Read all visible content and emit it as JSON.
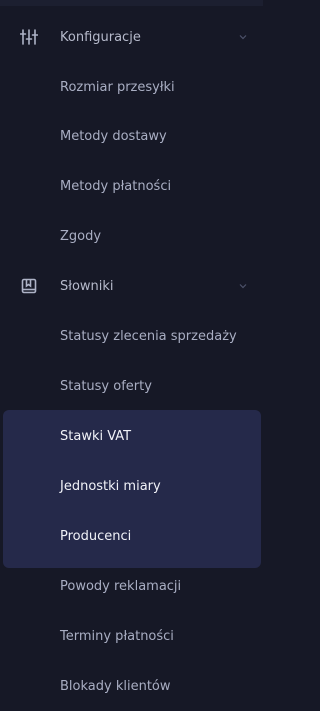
{
  "sidebar": {
    "groups": [
      {
        "label": "Konfiguracje",
        "icon": "sliders-icon",
        "expanded": true,
        "items": [
          {
            "label": "Rozmiar przesyłki"
          },
          {
            "label": "Metody dostawy"
          },
          {
            "label": "Metody płatności"
          },
          {
            "label": "Zgody"
          }
        ]
      },
      {
        "label": "Słowniki",
        "icon": "book-icon",
        "expanded": true,
        "items": [
          {
            "label": "Statusy zlecenia sprzedaży"
          },
          {
            "label": "Statusy oferty"
          },
          {
            "label": "Stawki VAT"
          },
          {
            "label": "Jednostki miary"
          },
          {
            "label": "Producenci"
          },
          {
            "label": "Powody reklamacji"
          },
          {
            "label": "Terminy płatności"
          },
          {
            "label": "Blokady klientów"
          }
        ]
      }
    ]
  },
  "colors": {
    "background": "#161826",
    "highlight_background": "#25294a",
    "text_muted": "#a9aec3",
    "text_bright": "#f1f2f8"
  }
}
